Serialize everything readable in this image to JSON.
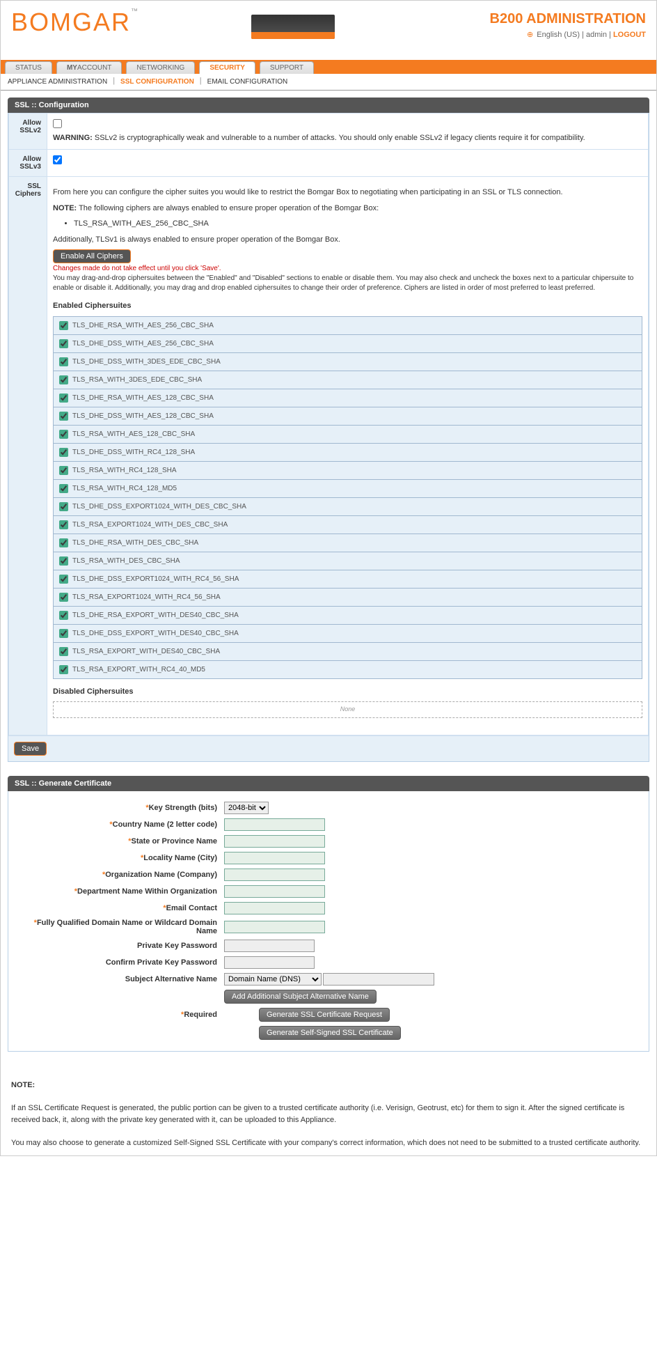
{
  "header": {
    "logo": "BOMGAR",
    "logo_tm": "™",
    "admin_title": "B200 ADMINISTRATION",
    "language": "English (US)",
    "user": "admin",
    "logout": "LOGOUT"
  },
  "tabs": [
    "STATUS",
    "MYACCOUNT",
    "NETWORKING",
    "SECURITY",
    "SUPPORT"
  ],
  "subtabs": [
    "APPLIANCE ADMINISTRATION",
    "SSL CONFIGURATION",
    "EMAIL CONFIGURATION"
  ],
  "ssl_config": {
    "header": "SSL :: Configuration",
    "allow_sslv2_label": "Allow SSLv2",
    "allow_sslv2_checked": false,
    "sslv2_warning_prefix": "WARNING:",
    "sslv2_warning": " SSLv2 is cryptographically weak and vulnerable to a number of attacks. You should only enable SSLv2 if legacy clients require it for compatibility.",
    "allow_sslv3_label": "Allow SSLv3",
    "allow_sslv3_checked": true,
    "ssl_ciphers_label": "SSL Ciphers",
    "intro": "From here you can configure the cipher suites you would like to restrict the Bomgar Box to negotiating when participating in an SSL or TLS connection.",
    "note_prefix": "NOTE:",
    "note_text": " The following ciphers are always enabled to ensure proper operation of the Bomgar Box:",
    "always_cipher": "TLS_RSA_WITH_AES_256_CBC_SHA",
    "tlsv1_note": "Additionally, TLSv1 is always enabled to ensure proper operation of the Bomgar Box.",
    "enable_all_btn": "Enable All Ciphers",
    "red_note": "Changes made do not take effect until you click 'Save'.",
    "drag_note": "You may drag-and-drop ciphersuites between the \"Enabled\" and \"Disabled\" sections to enable or disable them. You may also check and uncheck the boxes next to a particular chipersuite to enable or disable it. Additionally, you may drag and drop enabled ciphersuites to change their order of preference. Ciphers are listed in order of most preferred to least preferred.",
    "enabled_title": "Enabled Ciphersuites",
    "disabled_title": "Disabled Ciphersuites",
    "disabled_none": "None",
    "enabled_ciphers": [
      "TLS_DHE_RSA_WITH_AES_256_CBC_SHA",
      "TLS_DHE_DSS_WITH_AES_256_CBC_SHA",
      "TLS_DHE_DSS_WITH_3DES_EDE_CBC_SHA",
      "TLS_RSA_WITH_3DES_EDE_CBC_SHA",
      "TLS_DHE_RSA_WITH_AES_128_CBC_SHA",
      "TLS_DHE_DSS_WITH_AES_128_CBC_SHA",
      "TLS_RSA_WITH_AES_128_CBC_SHA",
      "TLS_DHE_DSS_WITH_RC4_128_SHA",
      "TLS_RSA_WITH_RC4_128_SHA",
      "TLS_RSA_WITH_RC4_128_MD5",
      "TLS_DHE_DSS_EXPORT1024_WITH_DES_CBC_SHA",
      "TLS_RSA_EXPORT1024_WITH_DES_CBC_SHA",
      "TLS_DHE_RSA_WITH_DES_CBC_SHA",
      "TLS_RSA_WITH_DES_CBC_SHA",
      "TLS_DHE_DSS_EXPORT1024_WITH_RC4_56_SHA",
      "TLS_RSA_EXPORT1024_WITH_RC4_56_SHA",
      "TLS_DHE_RSA_EXPORT_WITH_DES40_CBC_SHA",
      "TLS_DHE_DSS_EXPORT_WITH_DES40_CBC_SHA",
      "TLS_RSA_EXPORT_WITH_DES40_CBC_SHA",
      "TLS_RSA_EXPORT_WITH_RC4_40_MD5"
    ],
    "save_btn": "Save"
  },
  "gen_cert": {
    "header": "SSL :: Generate Certificate",
    "fields": {
      "key_strength": "Key Strength (bits)",
      "key_strength_value": "2048-bit",
      "country": "Country Name (2 letter code)",
      "state": "State or Province Name",
      "locality": "Locality Name (City)",
      "org": "Organization Name (Company)",
      "dept": "Department Name Within Organization",
      "email": "Email Contact",
      "fqdn": "Fully Qualified Domain Name or Wildcard Domain Name",
      "privkey": "Private Key Password",
      "confirm": "Confirm Private Key Password",
      "san": "Subject Alternative Name",
      "san_type": "Domain Name (DNS)",
      "add_san_btn": "Add Additional Subject Alternative Name",
      "required": "Required"
    },
    "gen_req_btn": "Generate SSL Certificate Request",
    "gen_self_btn": "Generate Self-Signed SSL Certificate"
  },
  "bottom_note": {
    "title": "NOTE:",
    "p1": "If an SSL Certificate Request is generated, the public portion can be given to a trusted certificate authority (i.e. Verisign, Geotrust, etc) for them to sign it. After the signed certificate is received back, it, along with the private key generated with it, can be uploaded to this Appliance.",
    "p2": "You may also choose to generate a customized Self-Signed SSL Certificate with your company's correct information, which does not need to be submitted to a trusted certificate authority."
  }
}
